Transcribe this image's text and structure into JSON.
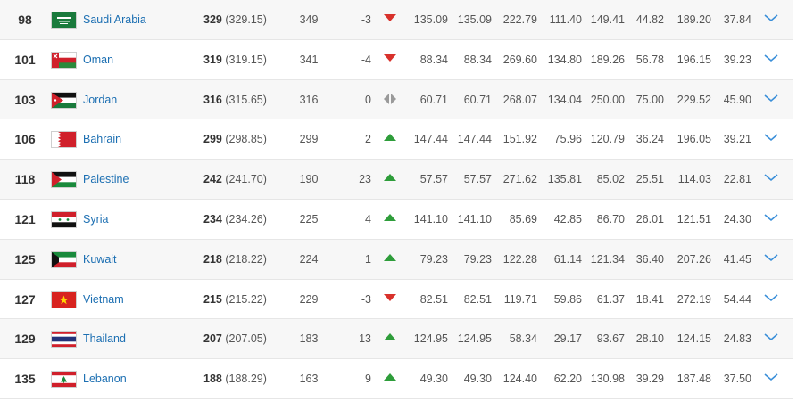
{
  "colors": {
    "link": "#1c6fb2",
    "up": "#2e9d3a",
    "down": "#d8312b",
    "same": "#9a9a9a",
    "expand": "#3a8fd9"
  },
  "rows": [
    {
      "rank": "98",
      "team": "Saudi Arabia",
      "flag": "saudi-arabia-flag-icon",
      "points": "329",
      "points_exact": "(329.15)",
      "prev_points": "349",
      "change": "-3",
      "movement": "down",
      "c1": "135.09",
      "c2": "135.09",
      "c3": "222.79",
      "c4": "111.40",
      "c5": "149.41",
      "c6": "44.82",
      "c7": "189.20",
      "c8": "37.84"
    },
    {
      "rank": "101",
      "team": "Oman",
      "flag": "oman-flag-icon",
      "points": "319",
      "points_exact": "(319.15)",
      "prev_points": "341",
      "change": "-4",
      "movement": "down",
      "c1": "88.34",
      "c2": "88.34",
      "c3": "269.60",
      "c4": "134.80",
      "c5": "189.26",
      "c6": "56.78",
      "c7": "196.15",
      "c8": "39.23"
    },
    {
      "rank": "103",
      "team": "Jordan",
      "flag": "jordan-flag-icon",
      "points": "316",
      "points_exact": "(315.65)",
      "prev_points": "316",
      "change": "0",
      "movement": "same",
      "c1": "60.71",
      "c2": "60.71",
      "c3": "268.07",
      "c4": "134.04",
      "c5": "250.00",
      "c6": "75.00",
      "c7": "229.52",
      "c8": "45.90"
    },
    {
      "rank": "106",
      "team": "Bahrain",
      "flag": "bahrain-flag-icon",
      "points": "299",
      "points_exact": "(298.85)",
      "prev_points": "299",
      "change": "2",
      "movement": "up",
      "c1": "147.44",
      "c2": "147.44",
      "c3": "151.92",
      "c4": "75.96",
      "c5": "120.79",
      "c6": "36.24",
      "c7": "196.05",
      "c8": "39.21"
    },
    {
      "rank": "118",
      "team": "Palestine",
      "flag": "palestine-flag-icon",
      "points": "242",
      "points_exact": "(241.70)",
      "prev_points": "190",
      "change": "23",
      "movement": "up",
      "c1": "57.57",
      "c2": "57.57",
      "c3": "271.62",
      "c4": "135.81",
      "c5": "85.02",
      "c6": "25.51",
      "c7": "114.03",
      "c8": "22.81"
    },
    {
      "rank": "121",
      "team": "Syria",
      "flag": "syria-flag-icon",
      "points": "234",
      "points_exact": "(234.26)",
      "prev_points": "225",
      "change": "4",
      "movement": "up",
      "c1": "141.10",
      "c2": "141.10",
      "c3": "85.69",
      "c4": "42.85",
      "c5": "86.70",
      "c6": "26.01",
      "c7": "121.51",
      "c8": "24.30"
    },
    {
      "rank": "125",
      "team": "Kuwait",
      "flag": "kuwait-flag-icon",
      "points": "218",
      "points_exact": "(218.22)",
      "prev_points": "224",
      "change": "1",
      "movement": "up",
      "c1": "79.23",
      "c2": "79.23",
      "c3": "122.28",
      "c4": "61.14",
      "c5": "121.34",
      "c6": "36.40",
      "c7": "207.26",
      "c8": "41.45"
    },
    {
      "rank": "127",
      "team": "Vietnam",
      "flag": "vietnam-flag-icon",
      "points": "215",
      "points_exact": "(215.22)",
      "prev_points": "229",
      "change": "-3",
      "movement": "down",
      "c1": "82.51",
      "c2": "82.51",
      "c3": "119.71",
      "c4": "59.86",
      "c5": "61.37",
      "c6": "18.41",
      "c7": "272.19",
      "c8": "54.44"
    },
    {
      "rank": "129",
      "team": "Thailand",
      "flag": "thailand-flag-icon",
      "points": "207",
      "points_exact": "(207.05)",
      "prev_points": "183",
      "change": "13",
      "movement": "up",
      "c1": "124.95",
      "c2": "124.95",
      "c3": "58.34",
      "c4": "29.17",
      "c5": "93.67",
      "c6": "28.10",
      "c7": "124.15",
      "c8": "24.83"
    },
    {
      "rank": "135",
      "team": "Lebanon",
      "flag": "lebanon-flag-icon",
      "points": "188",
      "points_exact": "(188.29)",
      "prev_points": "163",
      "change": "9",
      "movement": "up",
      "c1": "49.30",
      "c2": "49.30",
      "c3": "124.40",
      "c4": "62.20",
      "c5": "130.98",
      "c6": "39.29",
      "c7": "187.48",
      "c8": "37.50"
    }
  ]
}
